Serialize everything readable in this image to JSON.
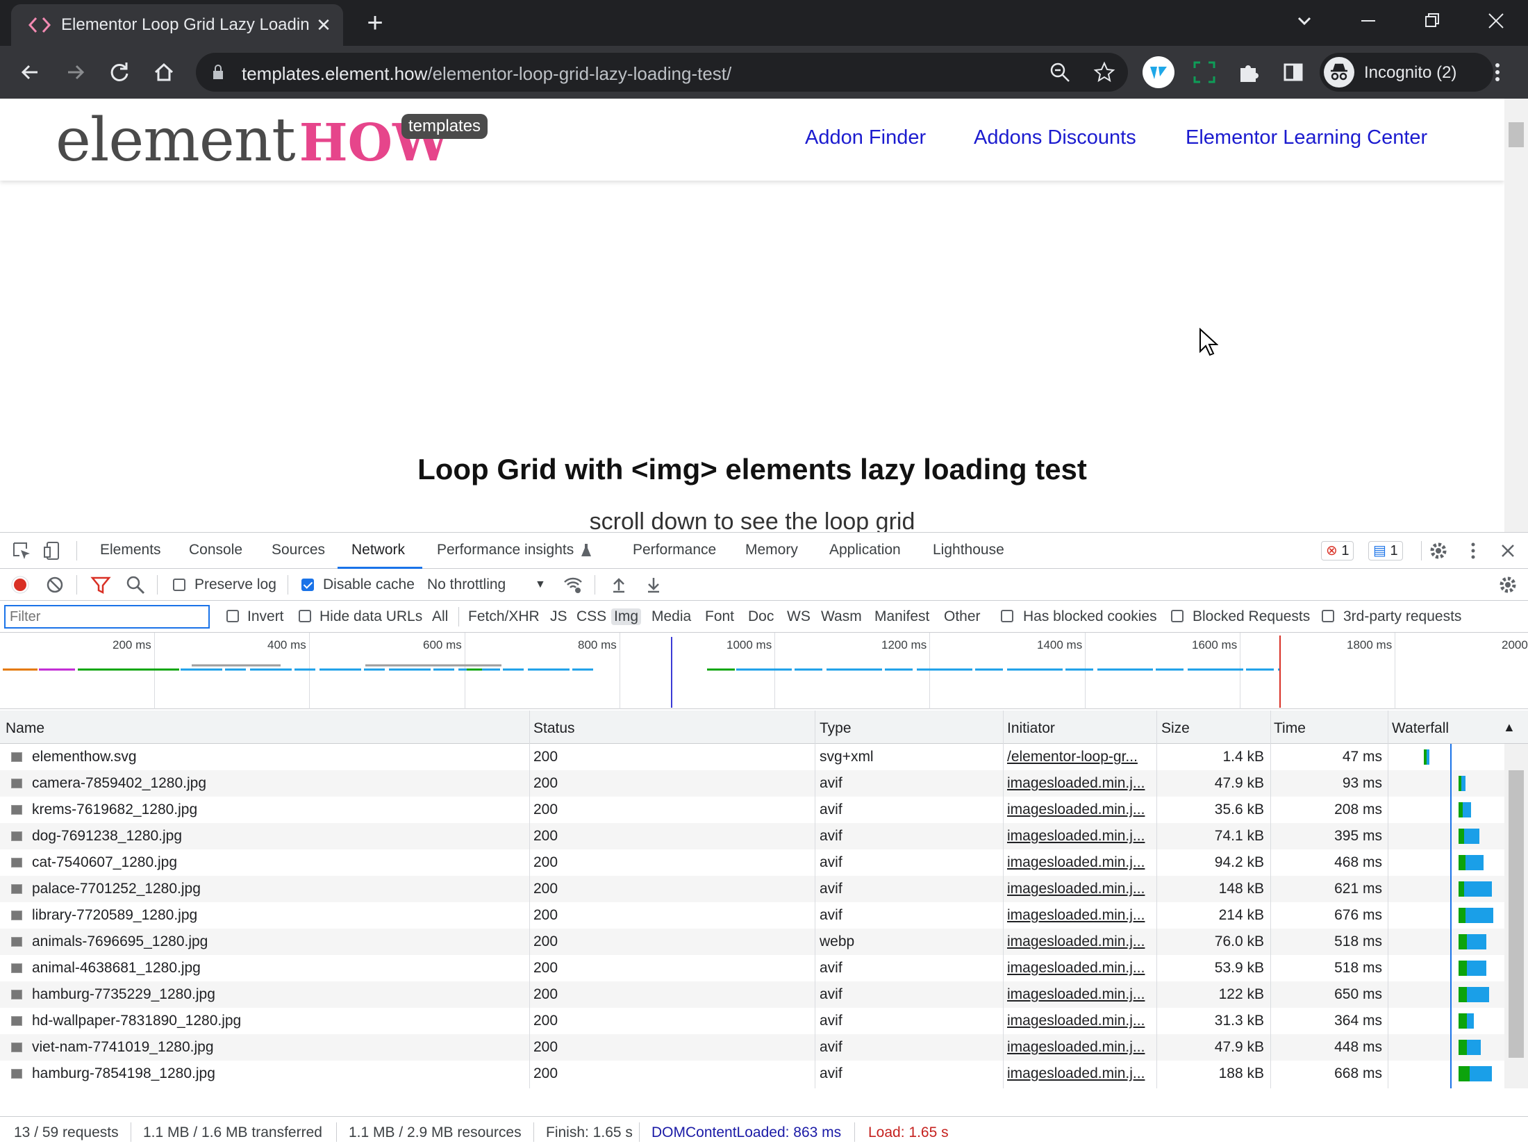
{
  "browser": {
    "tab_title": "Elementor Loop Grid Lazy Loadin",
    "url_host": "templates.element.how",
    "url_path": "/elementor-loop-grid-lazy-loading-test/",
    "profile_label": "Incognito (2)"
  },
  "site": {
    "logo_primary": "element",
    "logo_accent": "HOW",
    "logo_badge": "templates",
    "nav": [
      "Addon Finder",
      "Addons Discounts",
      "Elementor Learning Center"
    ],
    "heading": "Loop Grid with <img> elements lazy loading test",
    "subheading": "scroll down to see the loop grid"
  },
  "devtools": {
    "tabs": [
      "Elements",
      "Console",
      "Sources",
      "Network",
      "Performance insights",
      "Performance",
      "Memory",
      "Application",
      "Lighthouse"
    ],
    "active_tab": "Network",
    "error_count": "1",
    "message_count": "1",
    "preserve_log": "Preserve log",
    "disable_cache": "Disable cache",
    "throttling": "No throttling",
    "filter_placeholder": "Filter",
    "invert": "Invert",
    "hide_data_urls": "Hide data URLs",
    "type_filters": [
      "All",
      "Fetch/XHR",
      "JS",
      "CSS",
      "Img",
      "Media",
      "Font",
      "Doc",
      "WS",
      "Wasm",
      "Manifest",
      "Other"
    ],
    "active_type_filter": "Img",
    "has_blocked_cookies": "Has blocked cookies",
    "blocked_requests": "Blocked Requests",
    "third_party": "3rd-party requests",
    "timeline_ticks": [
      "200 ms",
      "400 ms",
      "600 ms",
      "800 ms",
      "1000 ms",
      "1200 ms",
      "1400 ms",
      "1600 ms",
      "1800 ms",
      "2000"
    ],
    "columns": [
      "Name",
      "Status",
      "Type",
      "Initiator",
      "Size",
      "Time",
      "Waterfall"
    ],
    "rows": [
      {
        "name": "elementhow.svg",
        "status": "200",
        "type": "svg+xml",
        "initiator": "/elementor-loop-gr...",
        "size": "1.4 kB",
        "time": "47 ms",
        "wait": 0.003,
        "recv": 0.002
      },
      {
        "name": "camera-7859402_1280.jpg",
        "status": "200",
        "type": "avif",
        "initiator": "imagesloaded.min.j...",
        "size": "47.9 kB",
        "time": "93 ms",
        "wait": 0.004,
        "recv": 0.006
      },
      {
        "name": "krems-7619682_1280.jpg",
        "status": "200",
        "type": "avif",
        "initiator": "imagesloaded.min.j...",
        "size": "35.6 kB",
        "time": "208 ms",
        "wait": 0.006,
        "recv": 0.012
      },
      {
        "name": "dog-7691238_1280.jpg",
        "status": "200",
        "type": "avif",
        "initiator": "imagesloaded.min.j...",
        "size": "74.1 kB",
        "time": "395 ms",
        "wait": 0.008,
        "recv": 0.022
      },
      {
        "name": "cat-7540607_1280.jpg",
        "status": "200",
        "type": "avif",
        "initiator": "imagesloaded.min.j...",
        "size": "94.2 kB",
        "time": "468 ms",
        "wait": 0.01,
        "recv": 0.026
      },
      {
        "name": "palace-7701252_1280.jpg",
        "status": "200",
        "type": "avif",
        "initiator": "imagesloaded.min.j...",
        "size": "148 kB",
        "time": "621 ms",
        "wait": 0.008,
        "recv": 0.04
      },
      {
        "name": "library-7720589_1280.jpg",
        "status": "200",
        "type": "avif",
        "initiator": "imagesloaded.min.j...",
        "size": "214 kB",
        "time": "676 ms",
        "wait": 0.01,
        "recv": 0.04
      },
      {
        "name": "animals-7696695_1280.jpg",
        "status": "200",
        "type": "webp",
        "initiator": "imagesloaded.min.j...",
        "size": "76.0 kB",
        "time": "518 ms",
        "wait": 0.012,
        "recv": 0.028
      },
      {
        "name": "animal-4638681_1280.jpg",
        "status": "200",
        "type": "avif",
        "initiator": "imagesloaded.min.j...",
        "size": "53.9 kB",
        "time": "518 ms",
        "wait": 0.012,
        "recv": 0.028
      },
      {
        "name": "hamburg-7735229_1280.jpg",
        "status": "200",
        "type": "avif",
        "initiator": "imagesloaded.min.j...",
        "size": "122 kB",
        "time": "650 ms",
        "wait": 0.012,
        "recv": 0.032
      },
      {
        "name": "hd-wallpaper-7831890_1280.jpg",
        "status": "200",
        "type": "avif",
        "initiator": "imagesloaded.min.j...",
        "size": "31.3 kB",
        "time": "364 ms",
        "wait": 0.012,
        "recv": 0.01
      },
      {
        "name": "viet-nam-7741019_1280.jpg",
        "status": "200",
        "type": "avif",
        "initiator": "imagesloaded.min.j...",
        "size": "47.9 kB",
        "time": "448 ms",
        "wait": 0.012,
        "recv": 0.02
      },
      {
        "name": "hamburg-7854198_1280.jpg",
        "status": "200",
        "type": "avif",
        "initiator": "imagesloaded.min.j...",
        "size": "188 kB",
        "time": "668 ms",
        "wait": 0.016,
        "recv": 0.032
      }
    ],
    "summary": {
      "requests": "13 / 59 requests",
      "transferred": "1.1 MB / 1.6 MB transferred",
      "resources": "1.1 MB / 2.9 MB resources",
      "finish": "Finish: 1.65 s",
      "dcl": "DOMContentLoaded: 863 ms",
      "load": "Load: 1.65 s"
    },
    "colors": {
      "accent": "#1a73e8",
      "waiting": "#0ca30c",
      "download": "#1a9fe8",
      "error": "#d93025"
    }
  }
}
